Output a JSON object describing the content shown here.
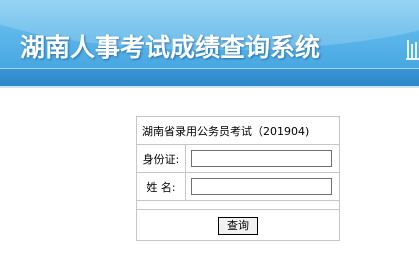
{
  "header": {
    "title": "湖南人事考试成绩查询系统"
  },
  "form": {
    "exam_title": "湖南省录用公务员考试（201904)",
    "id_label": "身份证:",
    "id_value": "",
    "name_label": "姓 名:",
    "name_value": "",
    "submit_label": "查询"
  }
}
